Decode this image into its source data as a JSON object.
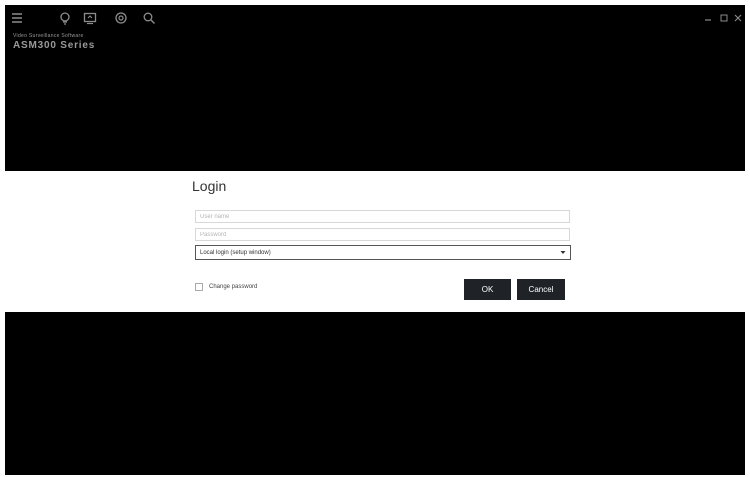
{
  "toolbar": {
    "icons": [
      "menu-icon",
      "bulb-icon",
      "monitor-icon",
      "settings-icon",
      "search-icon"
    ],
    "window_controls": [
      "minimize-icon",
      "restore-icon",
      "close-icon"
    ]
  },
  "brand": {
    "subtitle": "Video Surveillance Software",
    "title": "ASM300 Series"
  },
  "login": {
    "title": "Login",
    "username_placeholder": "User name",
    "password_placeholder": "Password",
    "login_mode_selected": "Local login (setup window)",
    "change_password_label": "Change password",
    "change_password_checked": false,
    "ok_label": "OK",
    "cancel_label": "Cancel"
  },
  "colors": {
    "background": "#000000",
    "panel": "#ffffff",
    "button": "#1f2328",
    "icon": "#8c8c8c"
  }
}
